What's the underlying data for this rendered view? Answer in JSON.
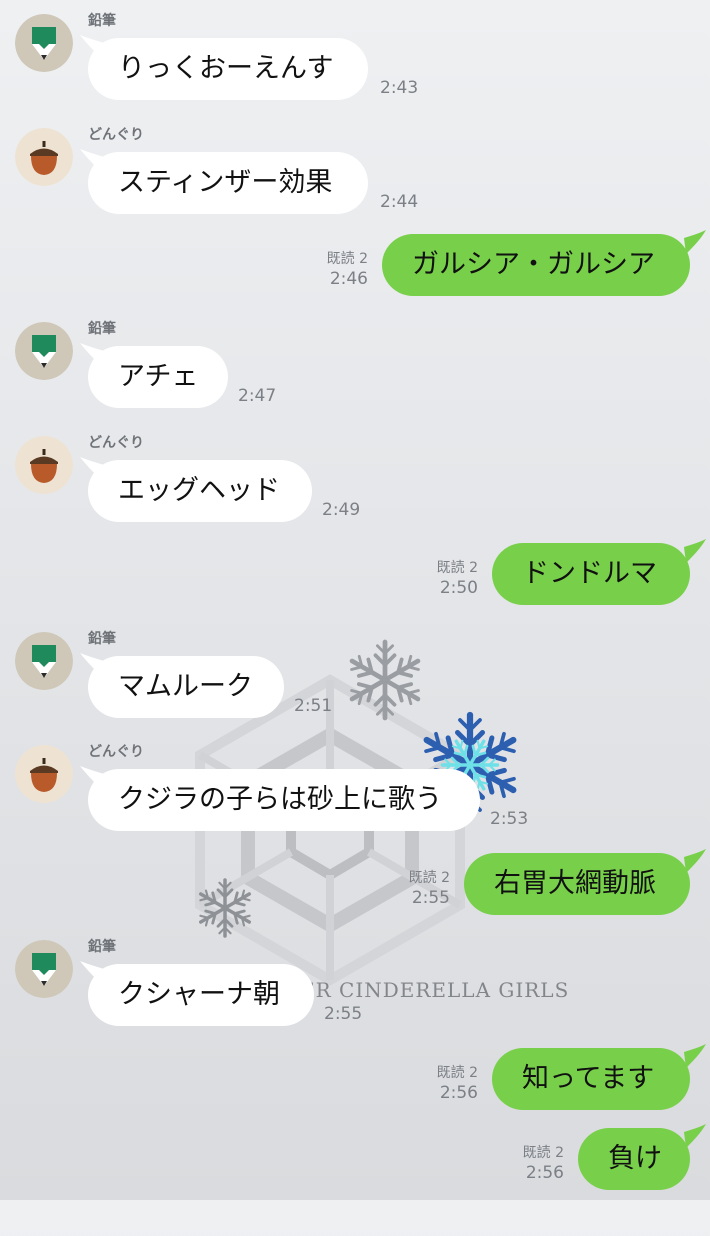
{
  "chat": {
    "messages": [
      {
        "direction": "in",
        "sender": "鉛筆",
        "text": "りっくおーえんす",
        "time": "2:43"
      },
      {
        "direction": "in",
        "sender": "どんぐり",
        "text": "スティンザー効果",
        "time": "2:44"
      },
      {
        "direction": "out",
        "read": "既読 2",
        "text": "ガルシア・ガルシア",
        "time": "2:46"
      },
      {
        "direction": "in",
        "sender": "鉛筆",
        "text": "アチェ",
        "time": "2:47"
      },
      {
        "direction": "in",
        "sender": "どんぐり",
        "text": "エッグヘッド",
        "time": "2:49"
      },
      {
        "direction": "out",
        "read": "既読 2",
        "text": "ドンドルマ",
        "time": "2:50"
      },
      {
        "direction": "in",
        "sender": "鉛筆",
        "text": "マムルーク",
        "time": "2:51"
      },
      {
        "direction": "in",
        "sender": "どんぐり",
        "text": "クジラの子らは砂上に歌う",
        "time": "2:53"
      },
      {
        "direction": "out",
        "read": "既読 2",
        "text": "右胃大網動脈",
        "time": "2:55"
      },
      {
        "direction": "in",
        "sender": "鉛筆",
        "text": "クシャーナ朝",
        "time": "2:55"
      },
      {
        "direction": "out",
        "read": "既読 2",
        "text": "知ってます",
        "time": "2:56"
      },
      {
        "direction": "out",
        "read": "既読 2",
        "text": "負け",
        "time": "2:56"
      }
    ]
  },
  "background": {
    "caption": "ER CINDERELLA GIRLS"
  },
  "colors": {
    "outgoing_bubble": "#78d04a",
    "incoming_bubble": "#ffffff",
    "pencil_avatar_green": "#1f8a5b",
    "acorn_avatar_brown": "#b85a2a"
  },
  "icons": {
    "pencil_avatar": "pencil-icon",
    "acorn_avatar": "acorn-icon",
    "background_art": "snowflake-icon"
  }
}
